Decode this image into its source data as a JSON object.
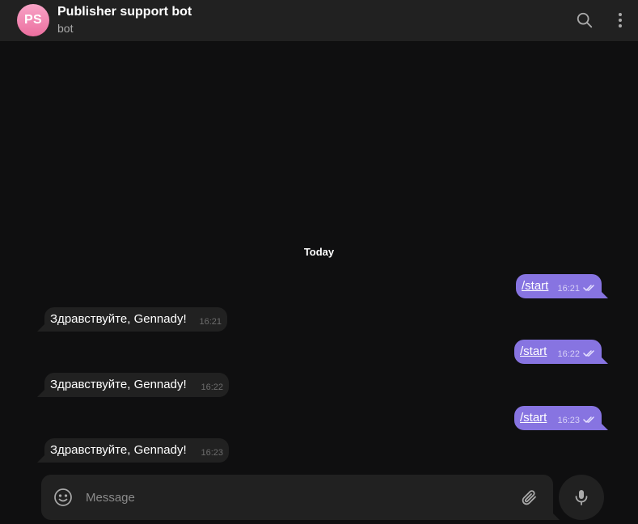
{
  "header": {
    "avatar_initials": "PS",
    "title": "Publisher support bot",
    "subtitle": "bot",
    "search_icon": "search-icon",
    "menu_icon": "more-vertical-icon"
  },
  "chat": {
    "date_label": "Today",
    "messages": [
      {
        "direction": "out",
        "text": "/start",
        "time": "16:21",
        "status": "read"
      },
      {
        "direction": "in",
        "text": "Здравствуйте, Gennady!",
        "time": "16:21"
      },
      {
        "direction": "out",
        "text": "/start",
        "time": "16:22",
        "status": "read"
      },
      {
        "direction": "in",
        "text": "Здравствуйте, Gennady!",
        "time": "16:22"
      },
      {
        "direction": "out",
        "text": "/start",
        "time": "16:23",
        "status": "read"
      },
      {
        "direction": "in",
        "text": "Здравствуйте, Gennady!",
        "time": "16:23"
      }
    ]
  },
  "composer": {
    "placeholder": "Message",
    "value": "",
    "emoji_icon": "smile-icon",
    "attach_icon": "paperclip-icon",
    "mic_icon": "microphone-icon"
  },
  "colors": {
    "accent": "#8774e1",
    "background": "#0f0f10",
    "surface": "#212121",
    "avatar_gradient_top": "#f7a3c6",
    "avatar_gradient_bottom": "#ec6f9f"
  }
}
